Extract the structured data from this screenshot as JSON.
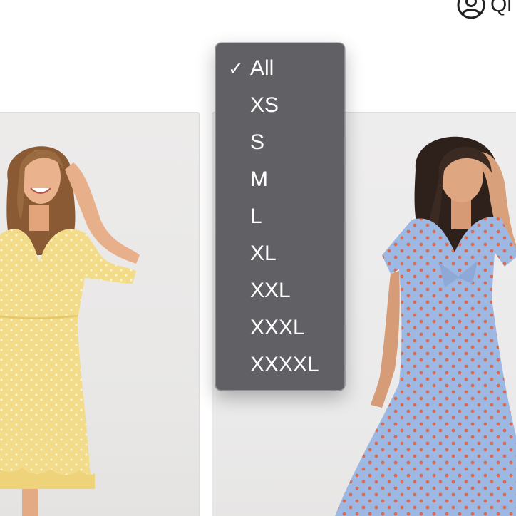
{
  "header": {
    "account_label": "Ql",
    "account_icon": "user-circle-icon"
  },
  "products": [
    {
      "dress_color": "#f2dc8a",
      "dots_color": "#fff6d8"
    },
    {
      "dress_color": "#9db8e3",
      "dots_color": "#d86b55"
    }
  ],
  "size_menu": {
    "selected": "All",
    "check_icon": "checkmark-icon",
    "items": [
      "All",
      "XS",
      "S",
      "M",
      "L",
      "XL",
      "XXL",
      "XXXL",
      "XXXXL"
    ],
    "background": "#5c5b60"
  }
}
